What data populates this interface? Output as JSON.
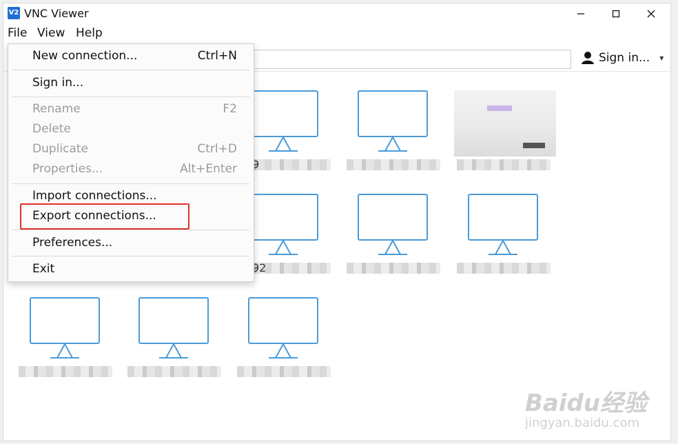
{
  "window": {
    "title": "VNC Viewer",
    "app_icon_text": "V2",
    "controls": [
      "minimize-icon",
      "maximize-icon",
      "close-icon"
    ]
  },
  "menubar": {
    "items": [
      "File",
      "View",
      "Help"
    ]
  },
  "toolbar": {
    "search_placeholder": "",
    "signin_label": "Sign in...",
    "signin_caret": "▾"
  },
  "file_menu": {
    "items": [
      {
        "label": "New connection...",
        "shortcut": "Ctrl+N",
        "enabled": true
      },
      {
        "label": "Sign in...",
        "shortcut": "",
        "enabled": true
      },
      {
        "label": "Rename",
        "shortcut": "F2",
        "enabled": false
      },
      {
        "label": "Delete",
        "shortcut": "",
        "enabled": false
      },
      {
        "label": "Duplicate",
        "shortcut": "Ctrl+D",
        "enabled": false
      },
      {
        "label": "Properties...",
        "shortcut": "Alt+Enter",
        "enabled": false
      },
      {
        "label": "Import connections...",
        "shortcut": "",
        "enabled": true
      },
      {
        "label": "Export connections...",
        "shortcut": "",
        "enabled": true,
        "highlighted": true
      },
      {
        "label": "Preferences...",
        "shortcut": "",
        "enabled": true
      },
      {
        "label": "Exit",
        "shortcut": "",
        "enabled": true
      }
    ],
    "highlight_color": "#e0302a"
  },
  "connections": {
    "visible_label_fragments": [
      "9",
      "92"
    ],
    "icon_color": "#4a9ad8"
  },
  "watermark": {
    "brand": "Baidu经验",
    "url": "jingyan.baidu.com"
  }
}
